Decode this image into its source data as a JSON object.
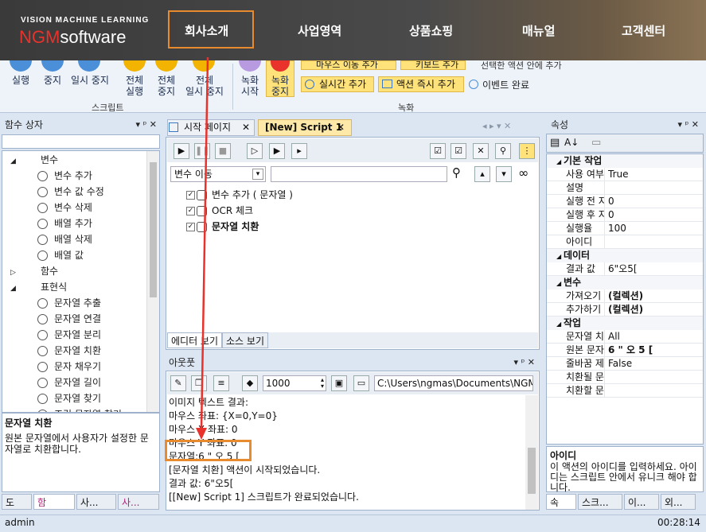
{
  "site": {
    "logo_sub": "VISION MACHINE LEARNING",
    "logo_ngm": "NGM",
    "logo_software": "software",
    "nav": [
      "회사소개",
      "사업영역",
      "상품쇼핑",
      "매뉴얼",
      "고객센터"
    ]
  },
  "ribbon": {
    "buttons": [
      {
        "label1": "실행",
        "label2": ""
      },
      {
        "label1": "중지",
        "label2": ""
      },
      {
        "label1": "일시 중지",
        "label2": ""
      },
      {
        "label1": "전체",
        "label2": "실행"
      },
      {
        "label1": "전체",
        "label2": "중지"
      },
      {
        "label1": "전체",
        "label2": "일시 중지"
      },
      {
        "label1": "녹화",
        "label2": "시작"
      },
      {
        "label1": "녹화",
        "label2": "중지"
      }
    ],
    "small": [
      "마우스 이동 추가",
      "키보드 추가",
      "선택한 액션 안에 추가",
      "실시간 추가",
      "액션 즉시 추가",
      "이벤트 완료"
    ],
    "group_script": "스크립트",
    "group_record": "녹화"
  },
  "left_panel": {
    "title": "함수 상자",
    "tree": [
      {
        "label": "변수",
        "level": 0
      },
      {
        "label": "변수 추가",
        "level": 1
      },
      {
        "label": "변수 값 수정",
        "level": 1
      },
      {
        "label": "변수 삭제",
        "level": 1
      },
      {
        "label": "배열 추가",
        "level": 1
      },
      {
        "label": "배열 삭제",
        "level": 1
      },
      {
        "label": "배열 값",
        "level": 1
      },
      {
        "label": "함수",
        "level": 0
      },
      {
        "label": "표현식",
        "level": 0
      },
      {
        "label": "문자열 추출",
        "level": 1
      },
      {
        "label": "문자열 연결",
        "level": 1
      },
      {
        "label": "문자열 분리",
        "level": 1
      },
      {
        "label": "문자열 치환",
        "level": 1
      },
      {
        "label": "문자 채우기",
        "level": 1
      },
      {
        "label": "문자열 길이",
        "level": 1
      },
      {
        "label": "문자열 찾기",
        "level": 1
      },
      {
        "label": "조건 문자열 찾기",
        "level": 1
      }
    ],
    "desc_title": "문자열 치환",
    "desc_text": "원본 문자열에서 사용자가 설정한 문자열로 치환합니다.",
    "tabs": [
      "도",
      "함",
      "사...",
      "사..."
    ]
  },
  "editor": {
    "tabs": [
      "시작 페이지",
      "[New] Script 1"
    ],
    "var_move": "변수 이동",
    "items": [
      {
        "label": "변수 추가 ( 문자열 )",
        "bold": false
      },
      {
        "label": "OCR 체크",
        "bold": false
      },
      {
        "label": "문자열 치환",
        "bold": true
      }
    ],
    "bottom_tabs": [
      "에디터 보기",
      "소스 보기"
    ]
  },
  "output": {
    "title": "아웃풋",
    "count": "1000",
    "path": "C:\\Users\\ngmas\\Documents\\NGM6\\",
    "lines": [
      "이미지 텍스트 결과:",
      "마우스 좌표: {X=0,Y=0}",
      "마우스 X 좌표: 0",
      "마우스 Y 좌표: 0",
      "문자열:6 \" 오 5 [",
      "[문자열 치환] 액션이 시작되었습니다.",
      "결과 값: 6\"오5[",
      "[[New] Script 1] 스크립트가 완료되었습니다."
    ]
  },
  "props": {
    "title": "속성",
    "cats": [
      {
        "name": "기본 작업",
        "rows": [
          [
            "사용 여부",
            "True"
          ],
          [
            "설명",
            ""
          ],
          [
            "실행 전 지",
            "0"
          ],
          [
            "실행 후 지",
            "0"
          ],
          [
            "실행율",
            "100"
          ],
          [
            "아이디",
            ""
          ]
        ]
      },
      {
        "name": "데이터",
        "rows": [
          [
            "결과 값",
            "6\"오5["
          ]
        ]
      },
      {
        "name": "변수",
        "rows": [
          [
            "가져오기",
            "(컬렉션)"
          ],
          [
            "추가하기",
            "(컬렉션)"
          ]
        ]
      },
      {
        "name": "작업",
        "rows": [
          [
            "문자열 치",
            "All"
          ],
          [
            "원본 문자",
            "6 \" 오 5 ["
          ],
          [
            "줄바꿈 제",
            "False"
          ],
          [
            "치환될 문",
            ""
          ],
          [
            "치환할 문",
            ""
          ]
        ]
      }
    ],
    "desc_title": "아이디",
    "desc_text": "이 액션의 아이디를 입력하세요. 아이디는 스크립트 안에서 유니크 해야 합니다.",
    "tabs": [
      "속",
      "스크...",
      "이...",
      "외..."
    ]
  },
  "status": {
    "user": "admin",
    "time": "00:28:14"
  },
  "colors": {
    "accent_orange": "#e88a2e",
    "arrow_red": "#e8322b"
  }
}
